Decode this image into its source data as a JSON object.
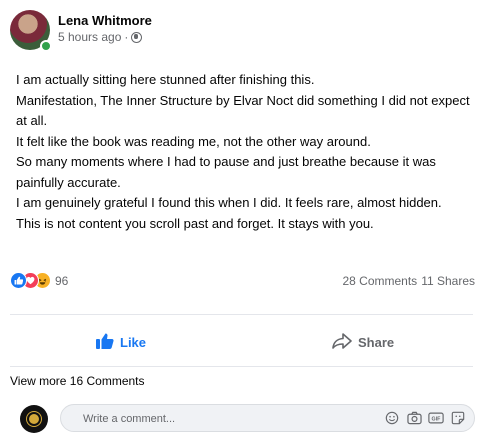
{
  "post": {
    "author": "Lena Whitmore",
    "time": "5 hours ago",
    "separator": "·",
    "privacy_icon": "globe-icon",
    "lines": [
      "I am actually sitting here stunned after finishing this.",
      "Manifestation, The Inner Structure by Elvar Noct did something I did not expect at all.",
      "It felt like the book was reading me, not the other way around.",
      "So many moments where I had to pause and just breathe because it was painfully accurate.",
      "I am genuinely grateful I found this when I did. It feels rare, almost hidden.",
      "This is not content you scroll past and forget. It stays with you."
    ]
  },
  "stats": {
    "reaction_count": "96",
    "comments": "28 Comments",
    "shares": "11 Shares",
    "reaction_icons": [
      "like-icon",
      "love-icon",
      "haha-icon"
    ]
  },
  "actions": {
    "like_label": "Like",
    "share_label": "Share"
  },
  "comments": {
    "view_more": "View more 16 Comments",
    "placeholder": "Write a comment..."
  },
  "colors": {
    "brand_blue": "#1877f2",
    "muted": "#65676b",
    "love": "#f33e58",
    "haha": "#f7b125",
    "online": "#31a24c"
  }
}
